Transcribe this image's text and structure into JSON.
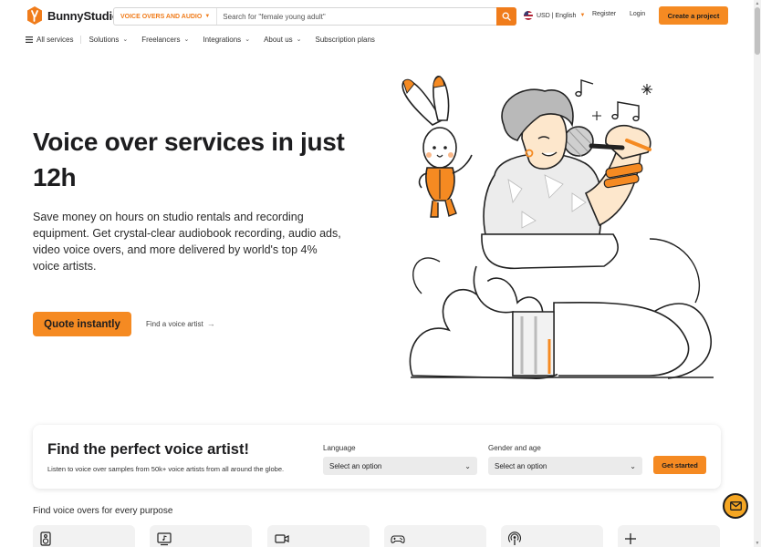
{
  "header": {
    "logo_text": "BunnyStudio",
    "search_category": "VOICE OVERS AND AUDIO",
    "search_placeholder": "Search for \"female young adult\"",
    "locale": "USD | English",
    "register": "Register",
    "login": "Login",
    "create_project": "Create a project"
  },
  "nav": {
    "all_services": "All services",
    "items": [
      "Solutions",
      "Freelancers",
      "Integrations",
      "About us",
      "Subscription plans"
    ]
  },
  "hero": {
    "title": "Voice over services in just 12h",
    "subtitle": "Save money on hours on studio rentals and recording equipment. Get crystal-clear audiobook recording, audio ads, video voice overs, and more delivered by world's top 4% voice artists.",
    "quote_button": "Quote instantly",
    "find_link": "Find a voice artist"
  },
  "finder": {
    "title": "Find the perfect voice artist!",
    "subtitle": "Listen to voice over samples from 50k+ voice artists from all around the globe.",
    "language_label": "Language",
    "language_value": "Select an option",
    "gender_label": "Gender and age",
    "gender_value": "Select an option",
    "get_started": "Get started"
  },
  "purpose": {
    "title": "Find voice overs for every purpose",
    "tiles": [
      {
        "icon": "speaker-icon"
      },
      {
        "icon": "screen-music-icon"
      },
      {
        "icon": "video-camera-icon"
      },
      {
        "icon": "gamepad-icon"
      },
      {
        "icon": "podcast-icon"
      },
      {
        "icon": "plus-icon"
      }
    ]
  },
  "colors": {
    "accent": "#f58a22",
    "text": "#1d1d1f"
  }
}
